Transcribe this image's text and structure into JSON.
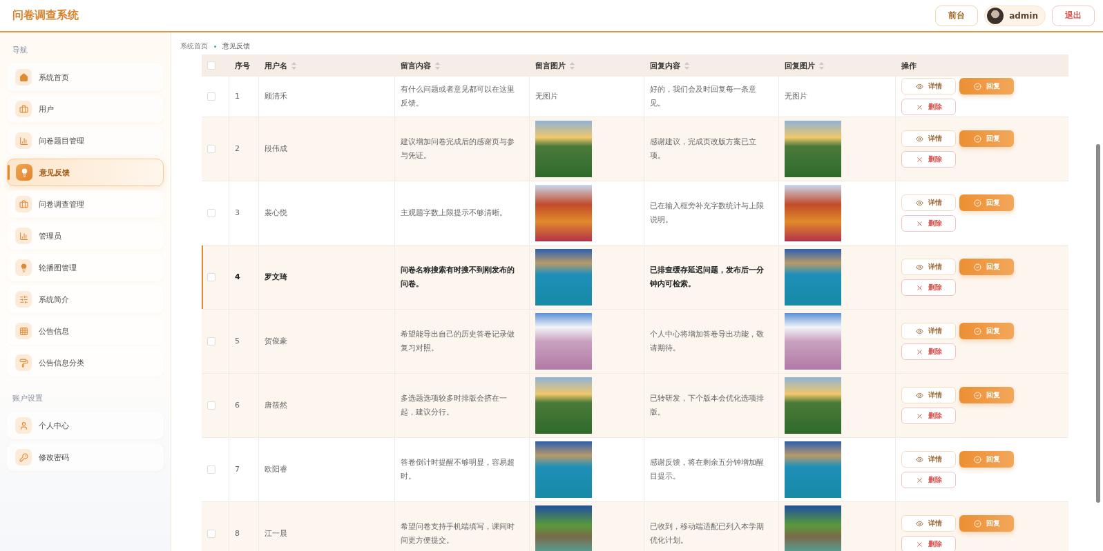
{
  "header": {
    "title": "问卷调查系统",
    "front_button": "前台",
    "user": {
      "name": "admin"
    },
    "logout_button": "退出"
  },
  "sidebar": {
    "sections": [
      {
        "label": "导航",
        "items": [
          {
            "label": "系统首页",
            "selected": false
          },
          {
            "label": "用户",
            "selected": false
          },
          {
            "label": "问卷题目管理",
            "selected": false
          },
          {
            "label": "意见反馈",
            "selected": true
          },
          {
            "label": "问卷调查管理",
            "selected": false
          },
          {
            "label": "管理员",
            "selected": false
          },
          {
            "label": "轮播图管理",
            "selected": false
          },
          {
            "label": "系统简介",
            "selected": false
          },
          {
            "label": "公告信息",
            "selected": false
          },
          {
            "label": "公告信息分类",
            "selected": false
          }
        ]
      },
      {
        "label": "账户设置",
        "items": [
          {
            "label": "个人中心",
            "selected": false
          },
          {
            "label": "修改密码",
            "selected": false
          }
        ]
      }
    ]
  },
  "breadcrumb": [
    "系统首页",
    "意见反馈"
  ],
  "table": {
    "select_all": {
      "checked": false
    },
    "columns": [
      {
        "label": "序号",
        "sortable": false
      },
      {
        "label": "用户名",
        "sortable": true
      },
      {
        "label": "留言内容",
        "sortable": true
      },
      {
        "label": "留言图片",
        "sortable": true
      },
      {
        "label": "回复内容",
        "sortable": true
      },
      {
        "label": "回复图片",
        "sortable": true
      },
      {
        "label": "操作",
        "sortable": false
      }
    ],
    "rows": [
      {
        "index": "1",
        "user": "顾清禾",
        "message": "有什么问题或者意见都可以在这里反馈。",
        "message_image": {
          "kind": "none",
          "text": "无图片"
        },
        "reply": "好的，我们会及时回复每一条意见。",
        "reply_image": {
          "kind": "none",
          "text": "无图片"
        },
        "checked": false,
        "shaded": false,
        "highlighted": false,
        "actions": [
          {
            "kind": "detail",
            "label": "详情"
          },
          {
            "kind": "reply",
            "label": "回复"
          },
          {
            "kind": "delete",
            "label": "删除"
          }
        ]
      },
      {
        "index": "2",
        "user": "段伟成",
        "message": "建议增加问卷完成后的感谢页与参与凭证。",
        "message_image": {
          "kind": "photo"
        },
        "reply": "感谢建议，完成页改版方案已立项。",
        "reply_image": {
          "kind": "photo"
        },
        "checked": false,
        "shaded": true,
        "highlighted": false,
        "actions": [
          {
            "kind": "detail",
            "label": "详情"
          },
          {
            "kind": "reply",
            "label": "回复"
          },
          {
            "kind": "delete",
            "label": "删除"
          }
        ]
      },
      {
        "index": "3",
        "user": "裴心悦",
        "message": "主观题字数上限提示不够清晰。",
        "message_image": {
          "kind": "photo"
        },
        "reply": "已在输入框旁补充字数统计与上限说明。",
        "reply_image": {
          "kind": "photo"
        },
        "checked": false,
        "shaded": false,
        "highlighted": false,
        "actions": [
          {
            "kind": "detail",
            "label": "详情"
          },
          {
            "kind": "reply",
            "label": "回复"
          },
          {
            "kind": "delete",
            "label": "删除"
          }
        ]
      },
      {
        "index": "4",
        "user": "罗文琦",
        "message": "问卷名称搜索有时搜不到刚发布的问卷。",
        "message_image": {
          "kind": "photo"
        },
        "reply": "已排查缓存延迟问题，发布后一分钟内可检索。",
        "reply_image": {
          "kind": "photo"
        },
        "checked": false,
        "shaded": true,
        "highlighted": true,
        "actions": [
          {
            "kind": "detail",
            "label": "详情"
          },
          {
            "kind": "reply",
            "label": "回复"
          },
          {
            "kind": "delete",
            "label": "删除"
          }
        ]
      },
      {
        "index": "5",
        "user": "贺俊豪",
        "message": "希望能导出自己的历史答卷记录做复习对照。",
        "message_image": {
          "kind": "photo"
        },
        "reply": "个人中心将增加答卷导出功能，敬请期待。",
        "reply_image": {
          "kind": "photo"
        },
        "checked": false,
        "shaded": true,
        "highlighted": false,
        "actions": [
          {
            "kind": "detail",
            "label": "详情"
          },
          {
            "kind": "reply",
            "label": "回复"
          },
          {
            "kind": "delete",
            "label": "删除"
          }
        ]
      },
      {
        "index": "6",
        "user": "唐筱然",
        "message": "多选题选项较多时排版会挤在一起，建议分行。",
        "message_image": {
          "kind": "photo"
        },
        "reply": "已转研发，下个版本会优化选项排版。",
        "reply_image": {
          "kind": "photo"
        },
        "checked": false,
        "shaded": true,
        "highlighted": false,
        "actions": [
          {
            "kind": "detail",
            "label": "详情"
          },
          {
            "kind": "reply",
            "label": "回复"
          },
          {
            "kind": "delete",
            "label": "删除"
          }
        ]
      },
      {
        "index": "7",
        "user": "欧阳睿",
        "message": "答卷倒计时提醒不够明显，容易超时。",
        "message_image": {
          "kind": "photo"
        },
        "reply": "感谢反馈，将在剩余五分钟增加醒目提示。",
        "reply_image": {
          "kind": "photo"
        },
        "checked": false,
        "shaded": false,
        "highlighted": false,
        "actions": [
          {
            "kind": "detail",
            "label": "详情"
          },
          {
            "kind": "reply",
            "label": "回复"
          },
          {
            "kind": "delete",
            "label": "删除"
          }
        ]
      },
      {
        "index": "8",
        "user": "江一晨",
        "message": "希望问卷支持手机端填写，课间时间更方便提交。",
        "message_image": {
          "kind": "photo"
        },
        "reply": "已收到，移动端适配已列入本学期优化计划。",
        "reply_image": {
          "kind": "photo"
        },
        "checked": false,
        "shaded": true,
        "highlighted": false,
        "actions": [
          {
            "kind": "detail",
            "label": "详情"
          },
          {
            "kind": "reply",
            "label": "回复"
          },
          {
            "kind": "delete",
            "label": "删除"
          }
        ]
      }
    ]
  }
}
